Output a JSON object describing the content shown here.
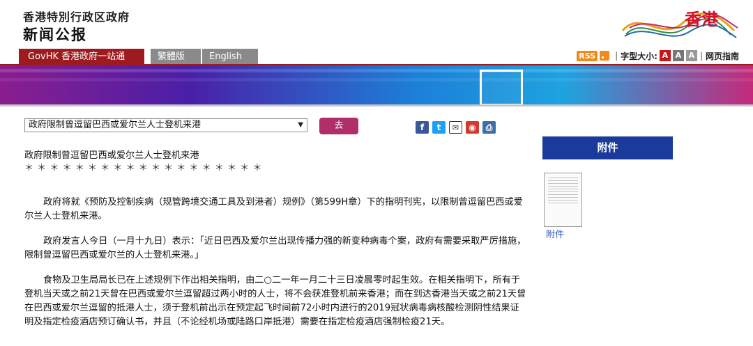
{
  "header": {
    "gov_name": "香港特別行政区政府",
    "press_title": "新闻公报",
    "logo_text": "香港"
  },
  "nav": {
    "govhk": "GovHK 香港政府一站通",
    "traditional": "繁體版",
    "english": "English"
  },
  "tools": {
    "rss": "RSS",
    "font_size_label": "字型大小:",
    "font_buttons": [
      "A",
      "A",
      "A"
    ],
    "page_guide": "网页指南"
  },
  "selector": {
    "selected": "政府限制曾逗留巴西或爱尔兰人士登机来港",
    "go_label": "去"
  },
  "share_icons": [
    "facebook-icon",
    "twitter-icon",
    "mail-icon",
    "weibo-icon",
    "print-icon"
  ],
  "article": {
    "title": "政府限制曾逗留巴西或爱尔兰人士登机来港",
    "stars": "＊＊＊＊＊＊＊＊＊＊＊＊＊＊＊＊＊＊＊",
    "paragraphs": [
      "政府将就《预防及控制疾病（规管跨境交通工具及到港者）规例》（第599H章）下的指明刊宪，以限制曾逗留巴西或爱尔兰人士登机来港。",
      "政府发言人今日（一月十九日）表示：「近日巴西及爱尔兰出现传播力强的新变种病毒个案，政府有需要采取严厉措施，限制曾逗留巴西或爱尔兰的人士登机来港。」",
      "食物及卫生局局长已在上述规例下作出相关指明，由二○二一年一月二十三日凌晨零时起生效。在相关指明下，所有于登机当天或之前21天曾在巴西或爱尔兰逗留超过两小时的人士，将不会获准登机前来香港；而在到达香港当天或之前21天曾在巴西或爱尔兰逗留的抵港人士，须于登机前出示在预定起飞时间前72小时内进行的2019冠状病毒病核酸检测阴性结果证明及指定检疫酒店预订确认书，并且（不论经机场或陆路口岸抵港）需要在指定检疫酒店强制检疫21天。"
    ]
  },
  "attachment": {
    "heading": "附件",
    "link": "附件"
  },
  "colors": {
    "brand_red": "#9d1a1e",
    "attach_blue": "#1a3a9c",
    "go_button": "#b02f6a"
  }
}
